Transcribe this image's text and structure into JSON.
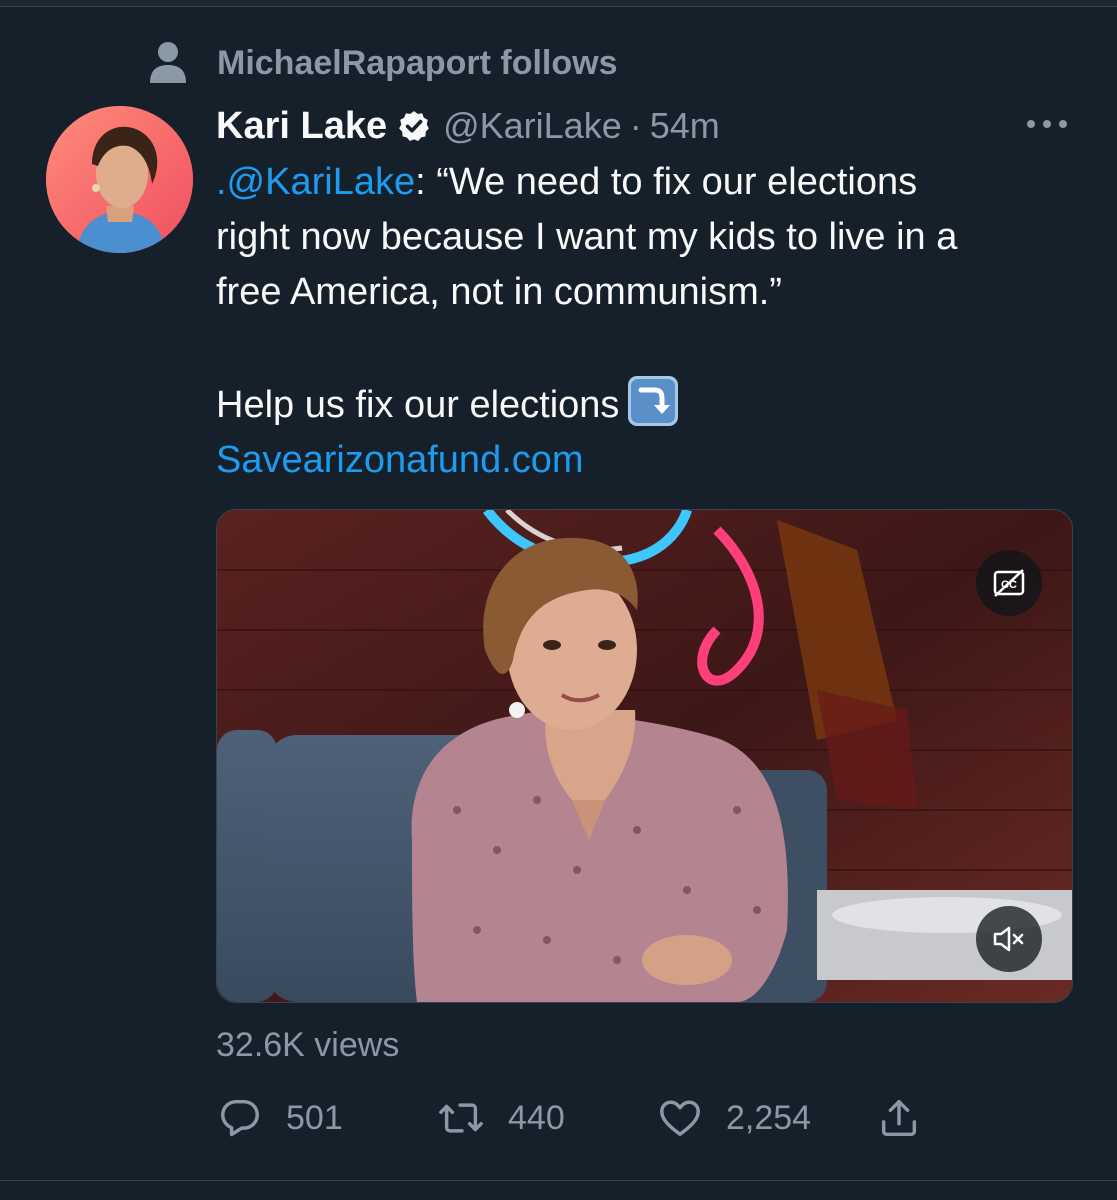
{
  "social_context": {
    "text": "MichaelRapaport follows",
    "icon": "person-icon"
  },
  "tweet": {
    "display_name": "Kari Lake",
    "verified": true,
    "handle": "@KariLake",
    "separator": "·",
    "time": "54m",
    "text": {
      "mention": ".@KariLake",
      "line1_rest": ": “We need to fix our elections",
      "line2": "right now because I want my kids to live in a",
      "line3": "free America, not in communism.”",
      "line4": "Help us fix our elections",
      "emoji": "arrow-right-curving-down-emoji",
      "link": "Savearizonafund.com"
    }
  },
  "media": {
    "type": "video",
    "captions_icon": "closed-captions-off-icon",
    "mute_icon": "muted-speaker-icon"
  },
  "views": "32.6K views",
  "actions": {
    "reply": {
      "icon": "reply-icon",
      "count": "501"
    },
    "retweet": {
      "icon": "retweet-icon",
      "count": "440"
    },
    "like": {
      "icon": "heart-icon",
      "count": "2,254"
    },
    "share": {
      "icon": "share-icon"
    }
  },
  "colors": {
    "background": "#15202b",
    "text": "#f7f9f9",
    "secondary": "#8b98a5",
    "accent": "#1d9bf0"
  }
}
